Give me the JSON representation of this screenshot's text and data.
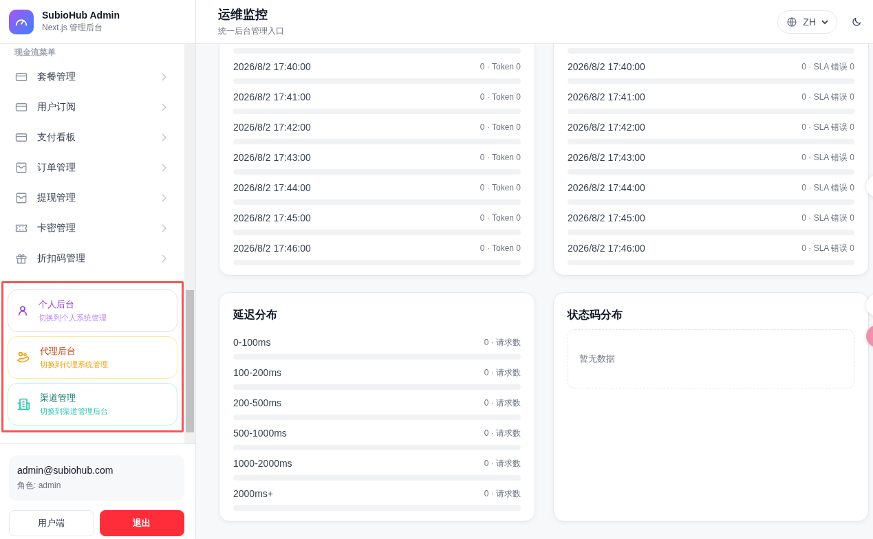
{
  "brand": {
    "title": "SubioHub Admin",
    "subtitle": "Next.js 管理后台"
  },
  "sidebar": {
    "section_label": "现金流菜单",
    "items": [
      {
        "label": "套餐管理",
        "kind": "card"
      },
      {
        "label": "用户订阅",
        "kind": "card"
      },
      {
        "label": "支付看板",
        "kind": "card"
      },
      {
        "label": "订单管理",
        "kind": "inbox"
      },
      {
        "label": "提现管理",
        "kind": "inbox"
      },
      {
        "label": "卡密管理",
        "kind": "ticket"
      },
      {
        "label": "折扣码管理",
        "kind": "gift"
      }
    ],
    "switches": [
      {
        "title": "个人后台",
        "subtitle": "切换到个人系统管理",
        "kind": "personal"
      },
      {
        "title": "代理后台",
        "subtitle": "切换到代理系统管理",
        "kind": "agent"
      },
      {
        "title": "渠道管理",
        "subtitle": "切换到渠道管理后台",
        "kind": "channel"
      }
    ],
    "user": {
      "email": "admin@subiohub.com",
      "role": "角色: admin"
    },
    "buttons": [
      {
        "label": "用户端",
        "kind": "secondary"
      },
      {
        "label": "退出",
        "kind": "danger"
      }
    ]
  },
  "header": {
    "title": "运维监控",
    "subtitle": "统一后台管理入口",
    "language": "ZH"
  },
  "token_panel": {
    "leading_bar": {
      "level": 0
    },
    "rows": [
      {
        "time": "2026/8/2 17:40:00",
        "stats": "0 · Token 0",
        "level": 0
      },
      {
        "time": "2026/8/2 17:41:00",
        "stats": "0 · Token 0",
        "level": 0
      },
      {
        "time": "2026/8/2 17:42:00",
        "stats": "0 · Token 0",
        "level": 0
      },
      {
        "time": "2026/8/2 17:43:00",
        "stats": "0 · Token 0",
        "level": 0
      },
      {
        "time": "2026/8/2 17:44:00",
        "stats": "0 · Token 0",
        "level": 0
      },
      {
        "time": "2026/8/2 17:45:00",
        "stats": "0 · Token 0",
        "level": 0
      },
      {
        "time": "2026/8/2 17:46:00",
        "stats": "0 · Token 0",
        "level": 0
      }
    ]
  },
  "sla_panel": {
    "leading_bar": {
      "level": 0
    },
    "rows": [
      {
        "time": "2026/8/2 17:40:00",
        "stats": "0 · SLA 错误 0",
        "level": 0
      },
      {
        "time": "2026/8/2 17:41:00",
        "stats": "0 · SLA 错误 0",
        "level": 0
      },
      {
        "time": "2026/8/2 17:42:00",
        "stats": "0 · SLA 错误 0",
        "level": 0
      },
      {
        "time": "2026/8/2 17:43:00",
        "stats": "0 · SLA 错误 0",
        "level": 0
      },
      {
        "time": "2026/8/2 17:44:00",
        "stats": "0 · SLA 错误 0",
        "level": 0
      },
      {
        "time": "2026/8/2 17:45:00",
        "stats": "0 · SLA 错误 0",
        "level": 0
      },
      {
        "time": "2026/8/2 17:46:00",
        "stats": "0 · SLA 错误 0",
        "level": 0
      }
    ]
  },
  "latency_panel": {
    "title": "延迟分布",
    "rows": [
      {
        "range": "0-100ms",
        "stats": "0 · 请求数",
        "level": 0
      },
      {
        "range": "100-200ms",
        "stats": "0 · 请求数",
        "level": 0
      },
      {
        "range": "200-500ms",
        "stats": "0 · 请求数",
        "level": 0
      },
      {
        "range": "500-1000ms",
        "stats": "0 · 请求数",
        "level": 0
      },
      {
        "range": "1000-2000ms",
        "stats": "0 · 请求数",
        "level": 0
      },
      {
        "range": "2000ms+",
        "stats": "0 · 请求数",
        "level": 0
      }
    ]
  },
  "status_panel": {
    "title": "状态码分布",
    "empty_text": "暂无数据"
  }
}
